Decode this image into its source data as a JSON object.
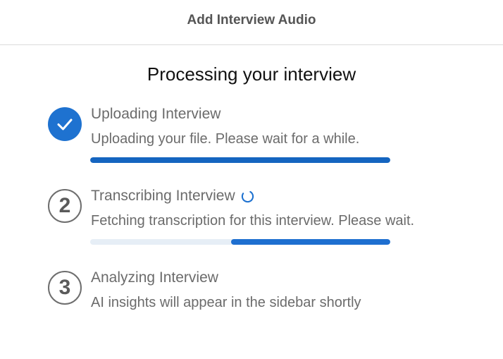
{
  "header": {
    "title": "Add Interview Audio"
  },
  "main": {
    "title": "Processing your interview"
  },
  "steps": [
    {
      "number": "1",
      "status": "complete",
      "icon": "checkmark-icon",
      "title": "Uploading Interview",
      "description": "Uploading your file. Please wait for a while.",
      "progress_percent": 100,
      "color": "#1565c0"
    },
    {
      "number": "2",
      "status": "in-progress",
      "icon": "spinner-icon",
      "title": "Transcribing Interview",
      "description": "Fetching transcription for this interview. Please wait.",
      "progress_start_percent": 47,
      "progress_end_percent": 100,
      "color": "#1e6fd0"
    },
    {
      "number": "3",
      "status": "pending",
      "title": "Analyzing Interview",
      "description": "AI insights will appear in the sidebar shortly"
    }
  ],
  "colors": {
    "accent": "#1e72d0",
    "text_muted": "#6b6b6b",
    "track": "#e6eef6"
  }
}
